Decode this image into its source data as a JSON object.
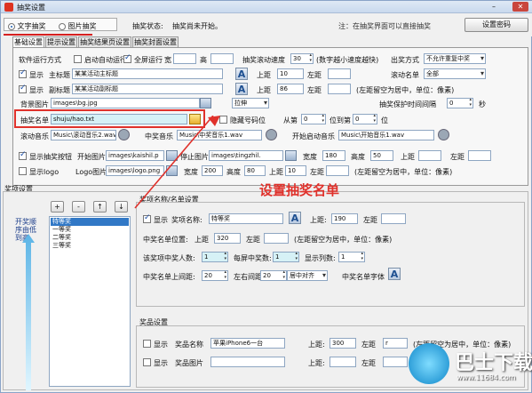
{
  "window": {
    "title": "抽奖设置"
  },
  "mode": {
    "text_mode": "文字抽奖",
    "image_mode": "图片抽奖",
    "status_label": "抽奖状态:",
    "status_value": "抽奖尚未开始。",
    "hint": "注：在抽奖界面可以直接抽奖",
    "set_password": "设置密码"
  },
  "tabs": [
    "基础设置",
    "提示设置",
    "抽奖结果页设置",
    "抽奖封面设置"
  ],
  "basic": {
    "run_mode_label": "软件运行方式",
    "auto_run": "启动自动运行",
    "fullscreen": "全屏运行",
    "width_label": "宽",
    "height_label": "高",
    "scroll_speed_label": "抽奖滚动速度",
    "scroll_speed_value": "30",
    "scroll_speed_hint": "(数字越小速度越快)",
    "appear_label": "出奖方式",
    "appear_value": "不允许重复中奖",
    "show": "显示",
    "main_title_label": "主标题",
    "main_title": "某某活动主标题",
    "sub_title_label": "副标题",
    "sub_title": "某某活动副标题",
    "top_label": "上距",
    "left_label": "左距",
    "main_top": "10",
    "sub_top": "86",
    "scroll_list_label": "滚动名单",
    "scroll_list_value": "全部",
    "margin_hint": "(左距留空为居中，单位：像素)",
    "bg_label": "背景图片",
    "bg_value": "images\\bg.jpg",
    "stretch": "拉伸",
    "namelist_label": "抽奖名单",
    "namelist_value": "shuju/hao.txt",
    "hide_num": "隐藏号码位",
    "from_label": "从第",
    "from_value": "0",
    "to_label": "位到第",
    "to_value": "0",
    "pos_label": "位",
    "protect_label": "抽奖保护时间间隔",
    "protect_value": "0",
    "sec_label": "秒",
    "scroll_music_label": "滚动音乐",
    "scroll_music": "Music\\滚动音乐2.wav",
    "win_music_label": "中奖音乐",
    "win_music": "Music\\中奖音乐1.wav",
    "start_music_label": "开始启动音乐",
    "start_music": "Music\\开始音乐1.wav",
    "show_btn": "显示抽奖按钮",
    "start_img_label": "开始图片",
    "start_img": "images\\kaishil.p",
    "stop_img_label": "停止图片",
    "stop_img": "images\\tingzhil.",
    "w_label": "宽度",
    "h_label": "高度",
    "btn_w": "180",
    "btn_h": "50",
    "show_logo": "显示logo",
    "logo_img_label": "Logo图片",
    "logo_img": "images\\logo.png",
    "logo_w": "200",
    "logo_h": "80",
    "logo_top": "10"
  },
  "prize": {
    "section_title": "奖项设置",
    "list_caption": "开奖顺序由低到高",
    "items": [
      "特等奖",
      "一等奖",
      "二等奖",
      "三等奖"
    ],
    "ctrl_add": "+",
    "ctrl_remove": "-",
    "ctrl_up": "↑",
    "ctrl_down": "↓",
    "name_group": "奖项名称/名单设置",
    "show": "显示",
    "name_label": "奖项名称:",
    "name_value": "特等奖",
    "top_label": "上距:",
    "top_value": "190",
    "left_label": "左距",
    "list_pos_label": "中奖名单位置:",
    "list_top_label": "上距",
    "list_top": "320",
    "list_left_label": "左距",
    "margin_hint": "(左距留空为居中，单位：像素)",
    "count_label": "该奖项中奖人数:",
    "count_value": "1",
    "each_label": "每屏中奖数:",
    "each_value": "1",
    "cols_label": "显示列数:",
    "cols_value": "1",
    "spacing_label": "中奖名单上间距:",
    "spacing_value": "20",
    "lr_label": "左右间距",
    "lr_value": "20",
    "align_value": "居中对齐",
    "font_label": "中奖名单字体",
    "goods_group": "奖品设置",
    "goods_name_label": "奖品名称",
    "goods_name": "苹果iPhone6一台",
    "goods_top": "300",
    "goods_left": "r",
    "goods_img_label": "奖品图片",
    "goods_hint": "(左距留空为居中，单位：像素)"
  },
  "annotation": {
    "text": "设置抽奖名单",
    "color": "#e0312b"
  },
  "watermark": {
    "name": "巴士下载",
    "url": "www.11684.com"
  }
}
